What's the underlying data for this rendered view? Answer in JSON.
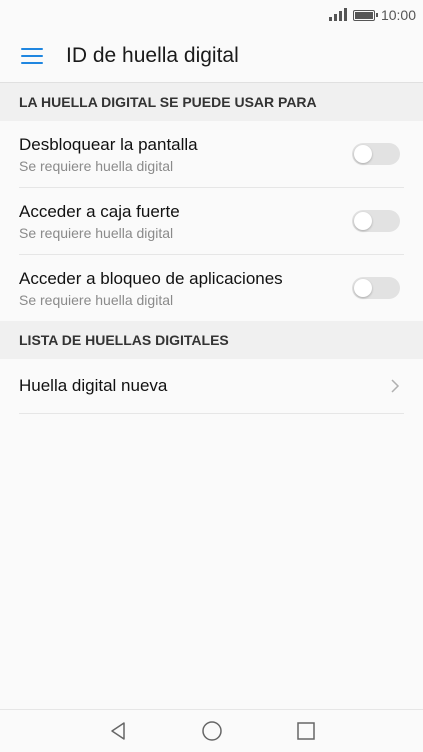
{
  "status_bar": {
    "time": "10:00",
    "icons": [
      "signal-icon",
      "battery-icon"
    ]
  },
  "app_bar": {
    "menu_icon": "menu-icon",
    "title": "ID de huella digital"
  },
  "sections": {
    "usage": {
      "header": "LA HUELLA DIGITAL SE PUEDE USAR PARA",
      "items": [
        {
          "title": "Desbloquear la pantalla",
          "subtitle": "Se requiere huella digital",
          "enabled": false
        },
        {
          "title": "Acceder a caja fuerte",
          "subtitle": "Se requiere huella digital",
          "enabled": false
        },
        {
          "title": "Acceder a bloqueo de aplicaciones",
          "subtitle": "Se requiere huella digital",
          "enabled": false
        }
      ]
    },
    "list": {
      "header": "LISTA DE HUELLAS DIGITALES",
      "items": [
        {
          "title": "Huella digital nueva",
          "icon": "chevron-right-icon"
        }
      ]
    }
  },
  "bottom_nav": {
    "icons": [
      "back-icon",
      "home-icon",
      "recents-icon"
    ]
  },
  "colors": {
    "accent": "#1f86e0",
    "toggle_off": "#e2e2e2",
    "section_bg": "#f0f0f0",
    "background": "#fafafa"
  }
}
